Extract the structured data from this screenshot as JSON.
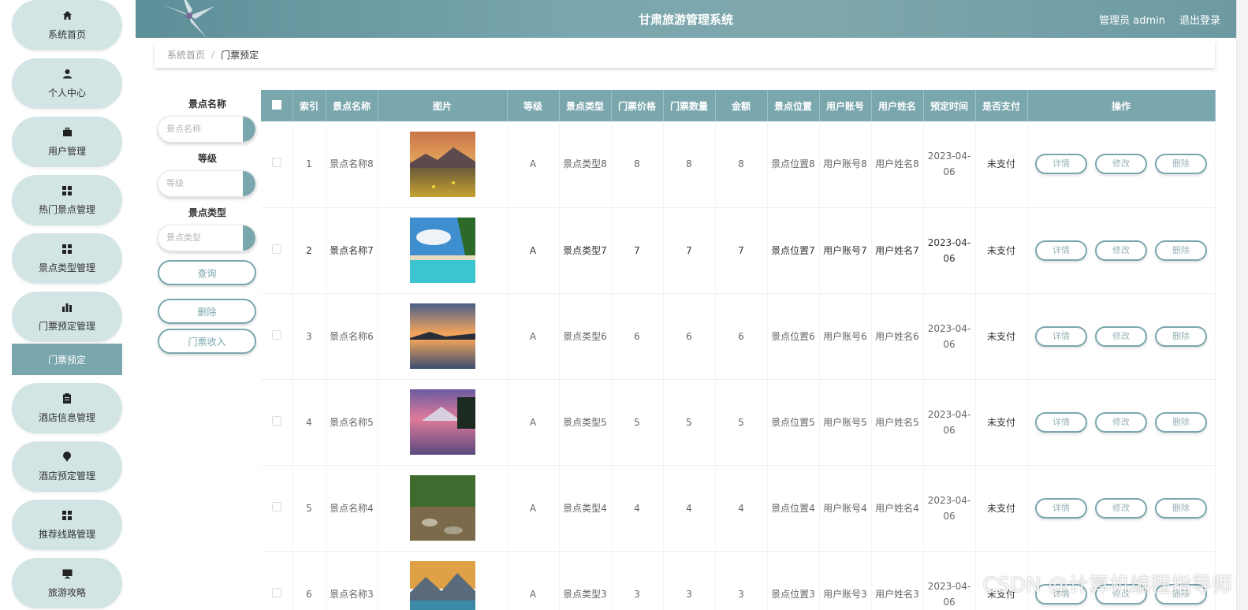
{
  "header": {
    "title": "甘肃旅游管理系统",
    "admin": "管理员 admin",
    "logout": "退出登录"
  },
  "sidebar": {
    "items": [
      {
        "label": "系统首页",
        "icon": "home-icon"
      },
      {
        "label": "个人中心",
        "icon": "user-icon"
      },
      {
        "label": "用户管理",
        "icon": "briefcase-icon"
      },
      {
        "label": "热门景点管理",
        "icon": "grid-icon"
      },
      {
        "label": "景点类型管理",
        "icon": "grid-icon"
      },
      {
        "label": "门票预定管理",
        "icon": "bar-chart-icon"
      },
      {
        "label": "酒店信息管理",
        "icon": "clipboard-icon"
      },
      {
        "label": "酒店预定管理",
        "icon": "pin-icon"
      },
      {
        "label": "推荐线路管理",
        "icon": "grid-icon"
      },
      {
        "label": "旅游攻略",
        "icon": "monitor-icon"
      }
    ],
    "active_sub": "门票预定"
  },
  "breadcrumb": {
    "home": "系统首页",
    "separator": "/",
    "current": "门票预定"
  },
  "search": {
    "name_label": "景点名称",
    "name_placeholder": "景点名称",
    "level_label": "等级",
    "level_placeholder": "等级",
    "type_label": "景点类型",
    "type_placeholder": "景点类型",
    "query_button": "查询",
    "delete_button": "删除",
    "income_button": "门票收入"
  },
  "table": {
    "headers": [
      "索引",
      "景点名称",
      "图片",
      "等级",
      "景点类型",
      "门票价格",
      "门票数量",
      "金额",
      "景点位置",
      "用户账号",
      "用户姓名",
      "预定时间",
      "是否支付",
      "操作"
    ],
    "actions": {
      "detail": "详情",
      "edit": "修改",
      "delete": "删除"
    },
    "rows": [
      {
        "index": "1",
        "name": "景点名称8",
        "level": "A",
        "type": "景点类型8",
        "price": "8",
        "qty": "8",
        "amount": "8",
        "location": "景点位置8",
        "account": "用户账号8",
        "username": "用户姓名8",
        "time": "2023-04-06",
        "paid": "未支付",
        "image": "meadow-sunset"
      },
      {
        "index": "2",
        "name": "景点名称7",
        "level": "A",
        "type": "景点类型7",
        "price": "7",
        "qty": "7",
        "amount": "7",
        "location": "景点位置7",
        "account": "用户账号7",
        "username": "用户姓名7",
        "time": "2023-04-06",
        "paid": "未支付",
        "image": "tropical-beach"
      },
      {
        "index": "3",
        "name": "景点名称6",
        "level": "A",
        "type": "景点类型6",
        "price": "6",
        "qty": "6",
        "amount": "6",
        "location": "景点位置6",
        "account": "用户账号6",
        "username": "用户姓名6",
        "time": "2023-04-06",
        "paid": "未支付",
        "image": "sunset-lake"
      },
      {
        "index": "4",
        "name": "景点名称5",
        "level": "A",
        "type": "景点类型5",
        "price": "5",
        "qty": "5",
        "amount": "5",
        "location": "景点位置5",
        "account": "用户账号5",
        "username": "用户姓名5",
        "time": "2023-04-06",
        "paid": "未支付",
        "image": "purple-mountain-lake"
      },
      {
        "index": "5",
        "name": "景点名称4",
        "level": "A",
        "type": "景点类型4",
        "price": "4",
        "qty": "4",
        "amount": "4",
        "location": "景点位置4",
        "account": "用户账号4",
        "username": "用户姓名4",
        "time": "2023-04-06",
        "paid": "未支付",
        "image": "forest-stream"
      },
      {
        "index": "6",
        "name": "景点名称3",
        "level": "A",
        "type": "景点类型3",
        "price": "3",
        "qty": "3",
        "amount": "3",
        "location": "景点位置3",
        "account": "用户账号3",
        "username": "用户姓名3",
        "time": "2023-04-06",
        "paid": "未支付",
        "image": "mountain-lake-sunrise"
      }
    ]
  },
  "watermark": "CSDN @计算机编程指导师",
  "colors": {
    "accent": "#7aa7ae",
    "nav_bg": "#d3e4e5",
    "header_bg": "#7aa6ad"
  }
}
